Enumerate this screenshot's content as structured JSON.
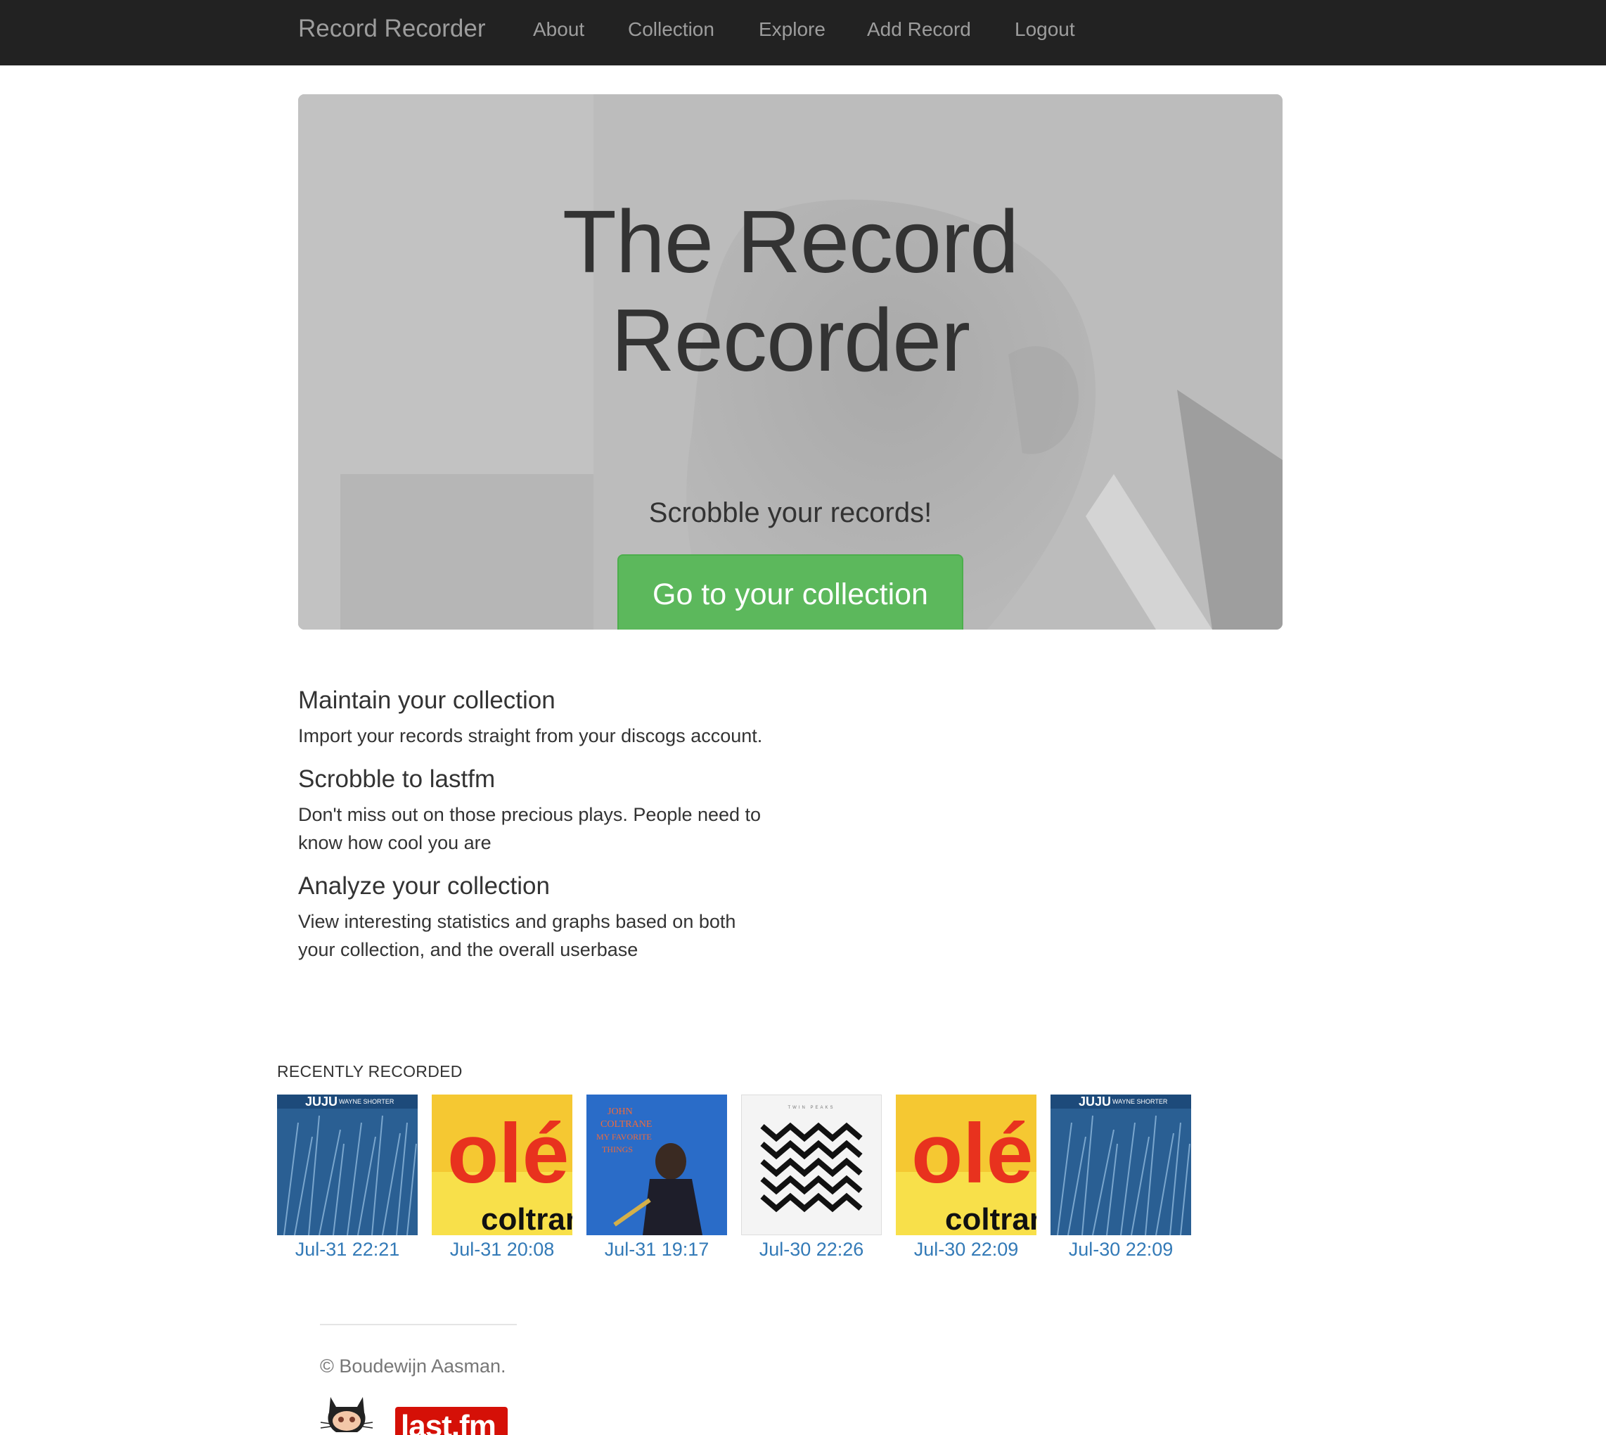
{
  "navbar": {
    "brand": "Record Recorder",
    "links": [
      "About",
      "Collection",
      "Explore",
      "Add Record",
      "Logout"
    ]
  },
  "hero": {
    "title_line1": "The Record",
    "title_line2": "Recorder",
    "subtitle": "Scrobble your records!",
    "button_label": "Go to your collection"
  },
  "features": [
    {
      "heading": "Maintain your collection",
      "text": "Import your records straight from your discogs account."
    },
    {
      "heading": "Scrobble to lastfm",
      "text": "Don't miss out on those precious plays. People need to know how cool you are"
    },
    {
      "heading": "Analyze your collection",
      "text": "View interesting statistics and graphs based on both your collection, and the overall userbase"
    }
  ],
  "recent": {
    "title": "RECENTLY RECORDED",
    "items": [
      {
        "date": "Jul-31 22:21",
        "album_lettering": "JUJU WAYNE SHORTER"
      },
      {
        "date": "Jul-31 20:08",
        "album_lettering": "olé coltrane"
      },
      {
        "date": "Jul-31 19:17",
        "album_lettering": "JOHN COLTRANE MY FAVORITE THINGS"
      },
      {
        "date": "Jul-30 22:26",
        "album_lettering": "TWIN PEAKS"
      },
      {
        "date": "Jul-30 22:09",
        "album_lettering": "olé coltrane"
      },
      {
        "date": "Jul-30 22:09",
        "album_lettering": "JUJU WAYNE SHORTER"
      }
    ]
  },
  "footer": {
    "copyright": "© Boudewijn Aasman.",
    "lastfm_logo_text": "last.fm"
  },
  "colors": {
    "navbar_bg": "#222222",
    "nav_text": "#9d9d9d",
    "button_green": "#5cb85c",
    "link_blue": "#337ab7",
    "lastfm_red": "#d51007"
  }
}
